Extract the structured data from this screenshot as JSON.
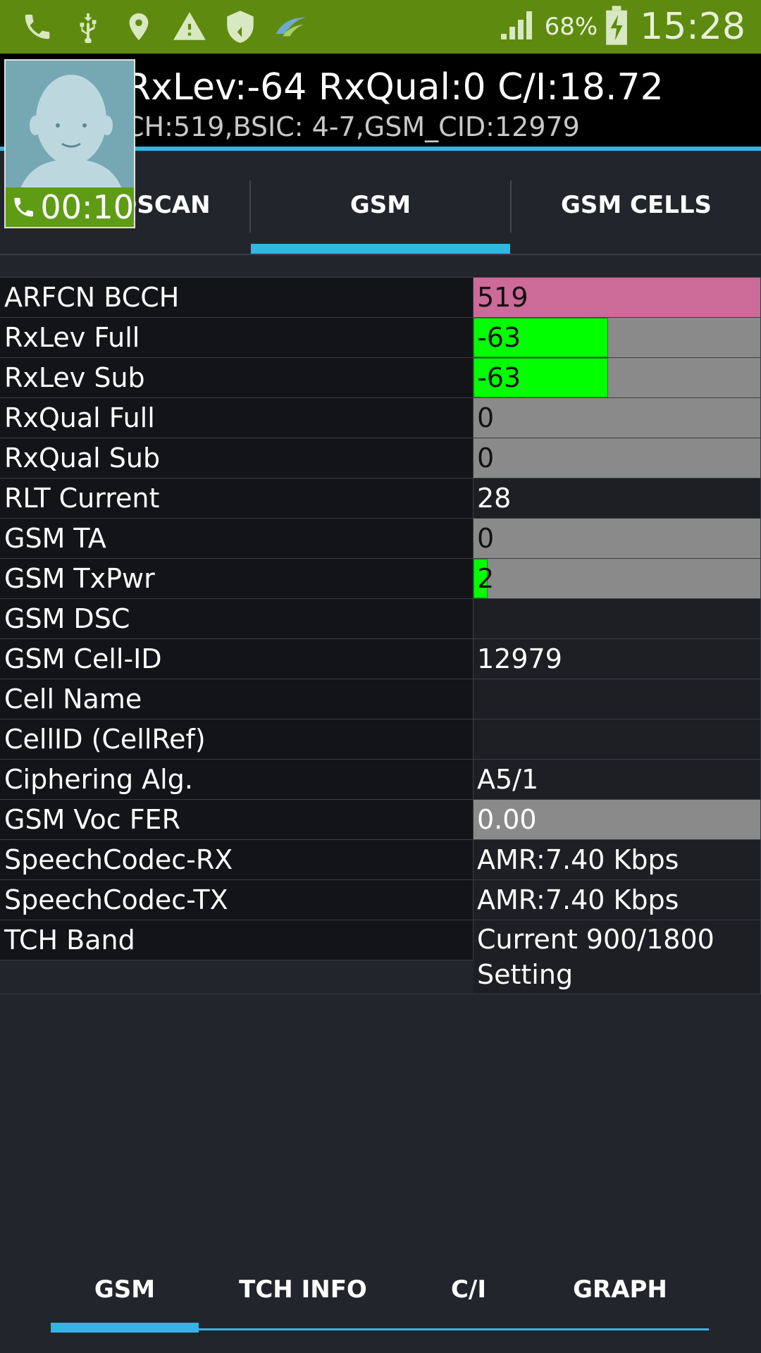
{
  "status_bar": {
    "icons_left": [
      "phone-icon",
      "usb-icon",
      "location-icon",
      "warning-icon",
      "shield-icon",
      "app-icon"
    ],
    "battery_percent": "68%",
    "time": "15:28"
  },
  "header": {
    "line1": "RxLev:-64 RxQual:0 C/I:18.72",
    "line2": "CH:519,BSIC: 4-7,GSM_CID:12979"
  },
  "call_overlay": {
    "timer": "00:10"
  },
  "top_tabs": [
    {
      "label": "QSCAN"
    },
    {
      "label": "GSM"
    },
    {
      "label": "GSM CELLS"
    }
  ],
  "rows": [
    {
      "label": "ARFCN BCCH",
      "value": "519"
    },
    {
      "label": "RxLev Full",
      "value": "-63",
      "bar_fraction": 0.47
    },
    {
      "label": "RxLev Sub",
      "value": "-63",
      "bar_fraction": 0.47
    },
    {
      "label": "RxQual Full",
      "value": "0"
    },
    {
      "label": "RxQual Sub",
      "value": "0"
    },
    {
      "label": "RLT Current",
      "value": "28"
    },
    {
      "label": "GSM TA",
      "value": "0"
    },
    {
      "label": "GSM TxPwr",
      "value": "2",
      "bar_fraction": 0.05
    },
    {
      "label": "GSM DSC",
      "value": ""
    },
    {
      "label": "GSM Cell-ID",
      "value": "12979"
    },
    {
      "label": "Cell Name",
      "value": ""
    },
    {
      "label": "CellID (CellRef)",
      "value": ""
    },
    {
      "label": "Ciphering Alg.",
      "value": "A5/1"
    },
    {
      "label": "GSM Voc FER",
      "value": "0.00"
    },
    {
      "label": "SpeechCodec-RX",
      "value": "AMR:7.40 Kbps"
    },
    {
      "label": "SpeechCodec-TX",
      "value": "AMR:7.40 Kbps"
    },
    {
      "label": "TCH Band",
      "value": "Current 900/1800 Setting"
    }
  ],
  "bottom_tabs": [
    {
      "label": "GSM"
    },
    {
      "label": "TCH INFO"
    },
    {
      "label": "C/I"
    },
    {
      "label": "GRAPH"
    }
  ],
  "colors": {
    "status_bar": "#5e8a10",
    "accent": "#33b5e5",
    "level_bar": "#00ff00",
    "highlight_pink": "#cc6a98",
    "neutral_gray": "#8a8a8a"
  }
}
